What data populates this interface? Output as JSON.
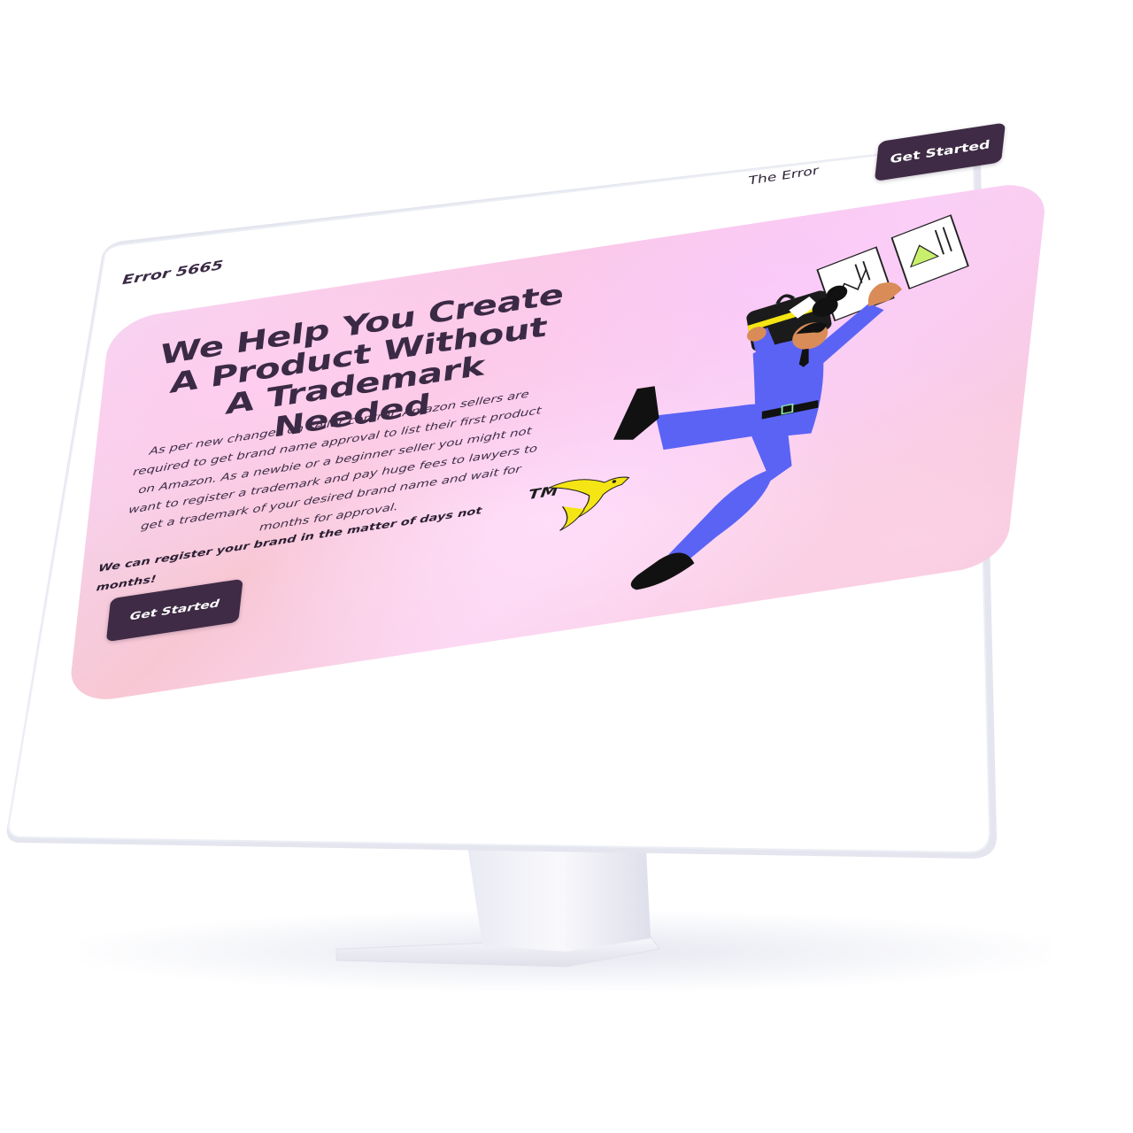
{
  "site": {
    "brand": "Error 5665",
    "nav": {
      "link_label": "The Error",
      "cta_label": "Get Started"
    }
  },
  "hero": {
    "title": "We Help You Create A Product Without A Trademark Needed",
    "body": "As per new changes on seller central, Amazon sellers are required to get brand name approval to list their first product on Amazon. As a newbie or a beginner seller you might not want to register a trademark and pay huge fees to lawyers to get a trademark of your desired brand name and wait for months for approval.",
    "emphasis": "We can register your brand in the matter of days not months!",
    "cta_label": "Get Started",
    "logo_text": "TM"
  },
  "colors": {
    "accent": "#3f2b45",
    "suit": "#5b63f5",
    "logo_yellow": "#f5e514"
  }
}
